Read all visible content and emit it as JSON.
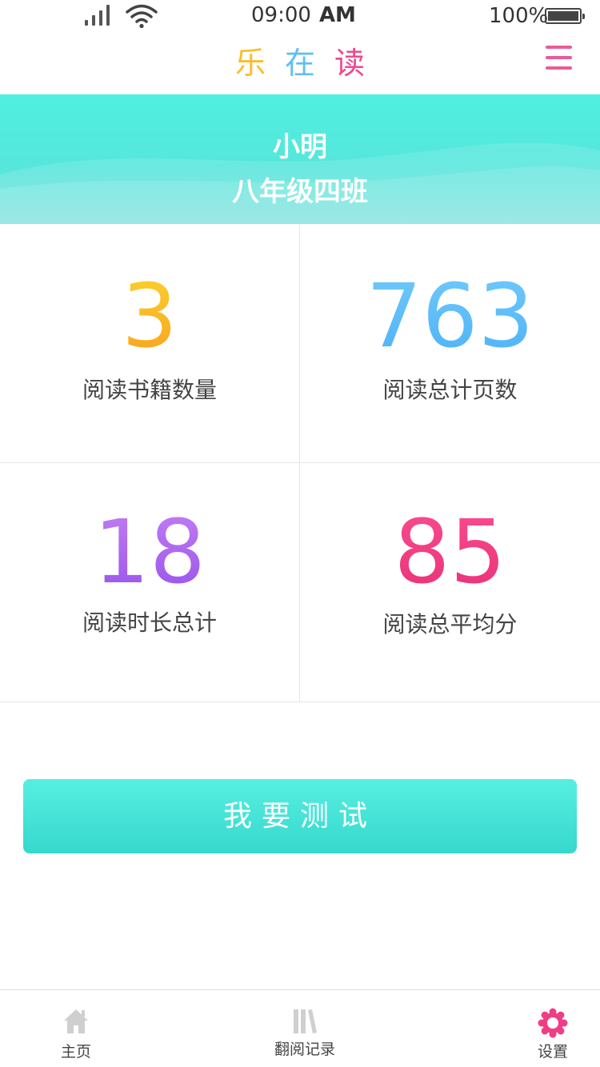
{
  "status": {
    "time": "09:00",
    "ampm": "AM",
    "battery": "100%"
  },
  "header": {
    "title_chars": [
      "乐",
      "在",
      "读"
    ],
    "title_colors": [
      "#fbbd28",
      "#5fbef5",
      "#ee4a90"
    ],
    "menu_icon": "hamburger-menu-icon",
    "menu_color": "#ec5a98"
  },
  "profile": {
    "name": "小明",
    "class": "八年级四班"
  },
  "stats": [
    {
      "value": "3",
      "label": "阅读书籍数量",
      "gradient": [
        "#fbd02c",
        "#f9a41f"
      ]
    },
    {
      "value": "763",
      "label": "阅读总计页数",
      "gradient": [
        "#6fc8fb",
        "#4fb3f6"
      ]
    },
    {
      "value": "18",
      "label": "阅读时长总计",
      "gradient": [
        "#c07cf3",
        "#9b55ec"
      ]
    },
    {
      "value": "85",
      "label": "阅读总平均分",
      "gradient": [
        "#f94b8f",
        "#ea3378"
      ]
    }
  ],
  "action": {
    "test_label": "我要测试"
  },
  "tabbar": {
    "home": {
      "label": "主页",
      "icon": "home-icon"
    },
    "history": {
      "label": "翻阅记录",
      "icon": "books-icon"
    },
    "settings": {
      "label": "设置",
      "icon": "gear-icon",
      "color": "#ee3f86"
    }
  }
}
